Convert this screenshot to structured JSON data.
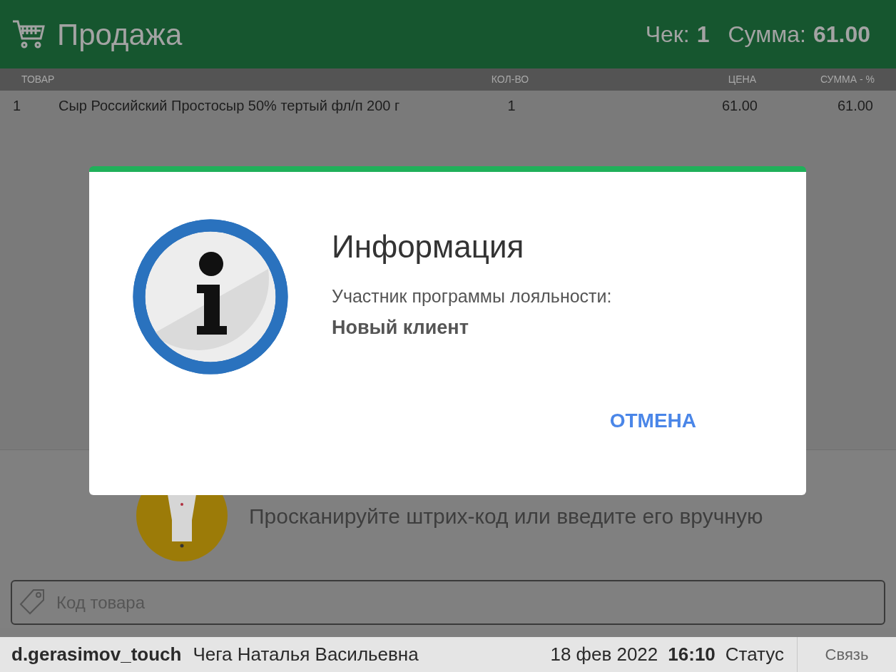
{
  "header": {
    "title": "Продажа",
    "receipt_label": "Чек:",
    "receipt_number": "1",
    "sum_label": "Сумма:",
    "sum_value": "61.00"
  },
  "table": {
    "columns": [
      "ТОВАР",
      "КОЛ-ВО",
      "ЦЕНА",
      "СУММА - %"
    ],
    "rows": [
      {
        "index": "1",
        "name": "Сыр Российский Простосыр 50% тертый фл/п 200 г",
        "quantity": "1",
        "price": "61.00",
        "sum": "61.00"
      }
    ]
  },
  "scan_hint": "Просканируйте штрих-код или введите его вручную",
  "code_field": {
    "placeholder": "Код товара"
  },
  "status_bar": {
    "user": "d.gerasimov_touch",
    "cashier": "Чега Наталья Васильевна",
    "date": "18 фев 2022",
    "time": "16:10",
    "status": "Статус",
    "connection_button": "Связь"
  },
  "dialog": {
    "title": "Информация",
    "message": "Участник программы лояльности:",
    "client": "Новый клиент",
    "buttons": [
      "ОТМЕНА"
    ]
  }
}
